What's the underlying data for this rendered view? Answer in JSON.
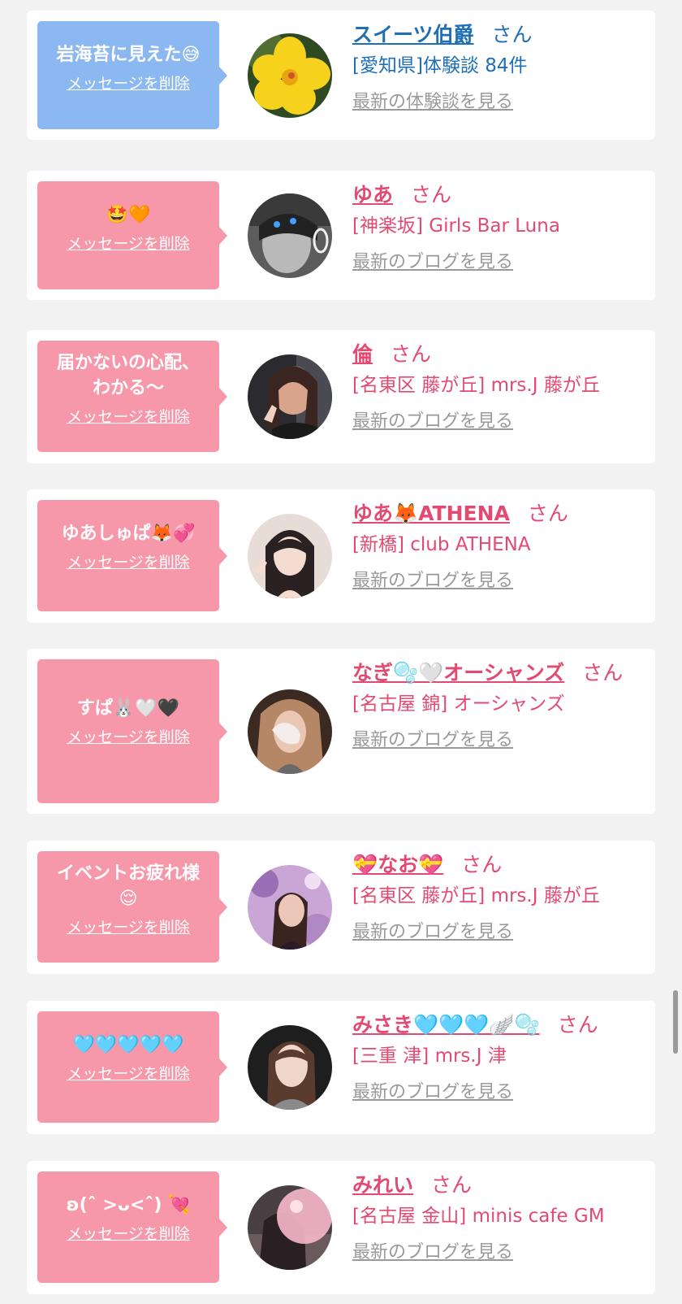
{
  "cards": [
    {
      "style": "blue",
      "bubble_text": "岩海苔に見えた😅",
      "delete_label": "メッセージを削除",
      "name": "スイーツ伯爵",
      "honorific": "さん",
      "subtitle": "[愛知県]体験談 84件",
      "link_label": "最新の体験談を見る",
      "avatar_icon": "yellow-hibiscus-photo"
    },
    {
      "style": "pink",
      "bubble_text": "🤩🧡",
      "delete_label": "メッセージを削除",
      "name": "ゆあ",
      "honorific": "さん",
      "subtitle": "[神楽坂] Girls Bar Luna",
      "link_label": "最新のブログを見る",
      "avatar_icon": "profile-photo"
    },
    {
      "style": "pink",
      "bubble_text": "届かないの心配、\nわかる〜",
      "delete_label": "メッセージを削除",
      "name": "倫",
      "honorific": "さん",
      "subtitle": "[名東区 藤が丘] mrs.J 藤が丘",
      "link_label": "最新のブログを見る",
      "avatar_icon": "profile-photo"
    },
    {
      "style": "pink",
      "bubble_text": "ゆあしゅぱ🦊💞",
      "delete_label": "メッセージを削除",
      "name": "ゆあ🦊ATHENA",
      "honorific": "さん",
      "subtitle": "[新橋] club ATHENA",
      "link_label": "最新のブログを見る",
      "avatar_icon": "profile-photo"
    },
    {
      "style": "pink",
      "bubble_text": "すぱ🐰🤍🖤",
      "delete_label": "メッセージを削除",
      "name": "なぎ🫧🤍オーシャンズ",
      "honorific": "さん",
      "subtitle": "[名古屋 錦] オーシャンズ",
      "link_label": "最新のブログを見る",
      "avatar_icon": "profile-photo"
    },
    {
      "style": "pink",
      "bubble_text": "イベントお疲れ様\n😌",
      "delete_label": "メッセージを削除",
      "name": "💝なお💝",
      "honorific": "さん",
      "subtitle": "[名東区 藤が丘] mrs.J 藤が丘",
      "link_label": "最新のブログを見る",
      "avatar_icon": "profile-photo"
    },
    {
      "style": "pink",
      "bubble_text": "🩵🩵🩵🩵🩵",
      "delete_label": "メッセージを削除",
      "name": "みさき🩵🩵🩵🪽🫧",
      "honorific": "さん",
      "subtitle": "[三重 津] mrs.J 津",
      "link_label": "最新のブログを見る",
      "avatar_icon": "profile-photo"
    },
    {
      "style": "pink",
      "bubble_text": "ʚ(ˆ >ᴗ<ˆ) 💘",
      "delete_label": "メッセージを削除",
      "name": "みれい",
      "honorific": "さん",
      "subtitle": "[名古屋 金山] minis cafe GM",
      "link_label": "最新のブログを見る",
      "avatar_icon": "profile-photo"
    }
  ]
}
